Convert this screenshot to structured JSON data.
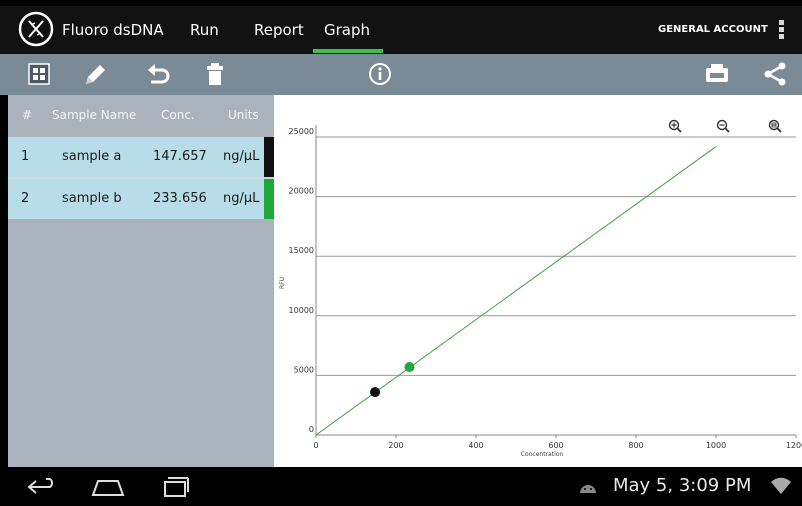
{
  "app": {
    "title": "Fluoro dsDNA",
    "logo_icon": "dna-icon"
  },
  "tabs": [
    {
      "label": "Run",
      "active": false
    },
    {
      "label": "Report",
      "active": false
    },
    {
      "label": "Graph",
      "active": true
    }
  ],
  "account_label": "GENERAL ACCOUNT",
  "toolbar": {
    "left_icons": [
      "grid-icon",
      "pencil-icon",
      "undo-icon",
      "trash-icon"
    ],
    "center_icon": "info-icon",
    "right_icons": [
      "print-icon",
      "share-icon"
    ]
  },
  "table": {
    "columns": [
      "#",
      "Sample Name",
      "Conc.",
      "Units"
    ],
    "rows": [
      {
        "index": "1",
        "name": "sample a",
        "conc": "147.657",
        "units": "ng/µL",
        "color": "#111111"
      },
      {
        "index": "2",
        "name": "sample b",
        "conc": "233.656",
        "units": "ng/µL",
        "color": "#1fa83c"
      }
    ]
  },
  "chart_data": {
    "type": "scatter",
    "xlabel": "Concentration",
    "ylabel": "RFU",
    "xlim": [
      0,
      1200
    ],
    "ylim": [
      0,
      25000
    ],
    "x_ticks": [
      "0",
      "200",
      "400",
      "600",
      "800",
      "1000",
      "1200"
    ],
    "y_ticks": [
      "0",
      "5000",
      "10000",
      "15000",
      "20000",
      "25000"
    ],
    "grid": "horizontal",
    "line": {
      "x": [
        0,
        1000
      ],
      "y": [
        0,
        24200
      ],
      "color": "#3f9f3f"
    },
    "points": [
      {
        "x": 147.657,
        "y": 3600,
        "color": "#111111"
      },
      {
        "x": 233.656,
        "y": 5700,
        "color": "#1fa83c"
      }
    ],
    "zoom_icons": [
      "zoom-in-icon",
      "zoom-out-icon",
      "zoom-reset-icon"
    ]
  },
  "navbar": {
    "icons": [
      "back-icon",
      "home-icon",
      "recents-icon",
      "android-icon",
      "wifi-icon"
    ],
    "clock": "May 5, 3:09 PM"
  }
}
